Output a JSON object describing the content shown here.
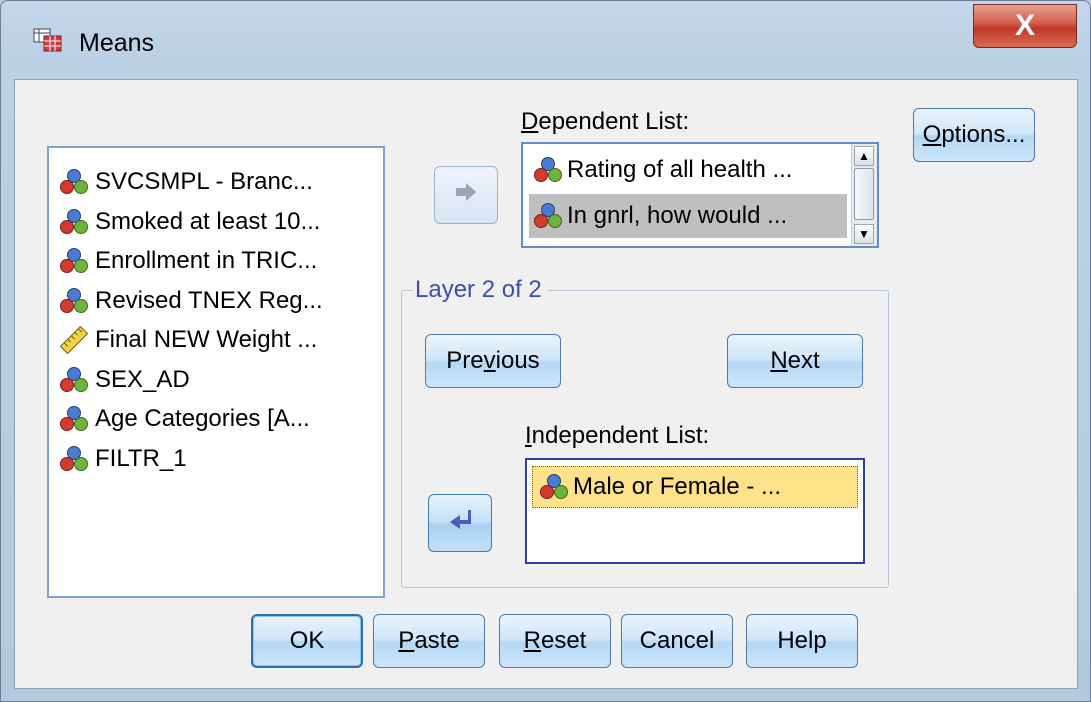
{
  "window": {
    "title": "Means",
    "close_glyph": "X"
  },
  "source_list": {
    "items": [
      {
        "label": "SVCSMPL - Branc...",
        "icon": "nominal-variable-icon"
      },
      {
        "label": "Smoked at least 10...",
        "icon": "nominal-variable-icon"
      },
      {
        "label": "Enrollment in TRIC...",
        "icon": "nominal-variable-icon"
      },
      {
        "label": "Revised TNEX Reg...",
        "icon": "nominal-variable-icon"
      },
      {
        "label": "Final NEW Weight ...",
        "icon": "scale-variable-icon"
      },
      {
        "label": "SEX_AD",
        "icon": "nominal-variable-icon"
      },
      {
        "label": "Age Categories [A...",
        "icon": "nominal-variable-icon"
      },
      {
        "label": "FILTR_1",
        "icon": "nominal-variable-icon"
      }
    ]
  },
  "dependent": {
    "label": "Dependent List:",
    "items": [
      {
        "label": "Rating of all health ...",
        "selected": false
      },
      {
        "label": "In gnrl, how would ...",
        "selected": true
      }
    ]
  },
  "layer": {
    "legend": "Layer 2 of 2",
    "previous_label": "Previous",
    "next_label": "Next",
    "independent_label": "Independent List:",
    "independent_items": [
      {
        "label": "Male or Female  - ..."
      }
    ]
  },
  "buttons": {
    "options": "Options...",
    "ok": "OK",
    "paste": "Paste",
    "reset": "Reset",
    "cancel": "Cancel",
    "help": "Help"
  },
  "colors": {
    "selection_gray": "#bfbfbf",
    "independent_highlight": "#fde28a",
    "legend_text": "#3b4fb0"
  }
}
